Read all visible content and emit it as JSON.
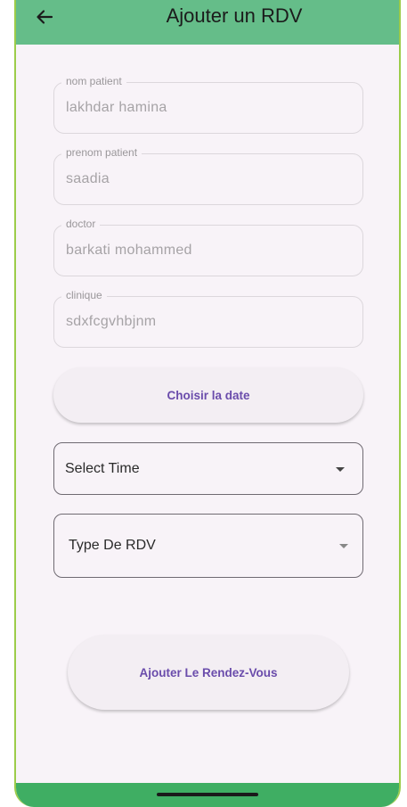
{
  "appbar": {
    "title": "Ajouter un RDV",
    "back_icon": "arrow-left-icon",
    "color": "#65bd89"
  },
  "form": {
    "nom_patient": {
      "label": "nom patient",
      "value": "lakhdar hamina"
    },
    "prenom_patient": {
      "label": "prenom patient",
      "value": "saadia"
    },
    "doctor": {
      "label": "doctor",
      "value": "barkati mohammed"
    },
    "clinique": {
      "label": "clinique",
      "value": "sdxfcgvhbjnm"
    },
    "date_button": "Choisir la date",
    "time_select": {
      "text": "Select Time",
      "icon": "caret-down-icon"
    },
    "type_select": {
      "text": "Type De RDV",
      "icon": "caret-down-icon"
    },
    "submit_button": "Ajouter Le Rendez-Vous"
  },
  "colors": {
    "accent": "#6a4cab",
    "background": "#f8f3f8",
    "navbar": "#3fae63"
  }
}
